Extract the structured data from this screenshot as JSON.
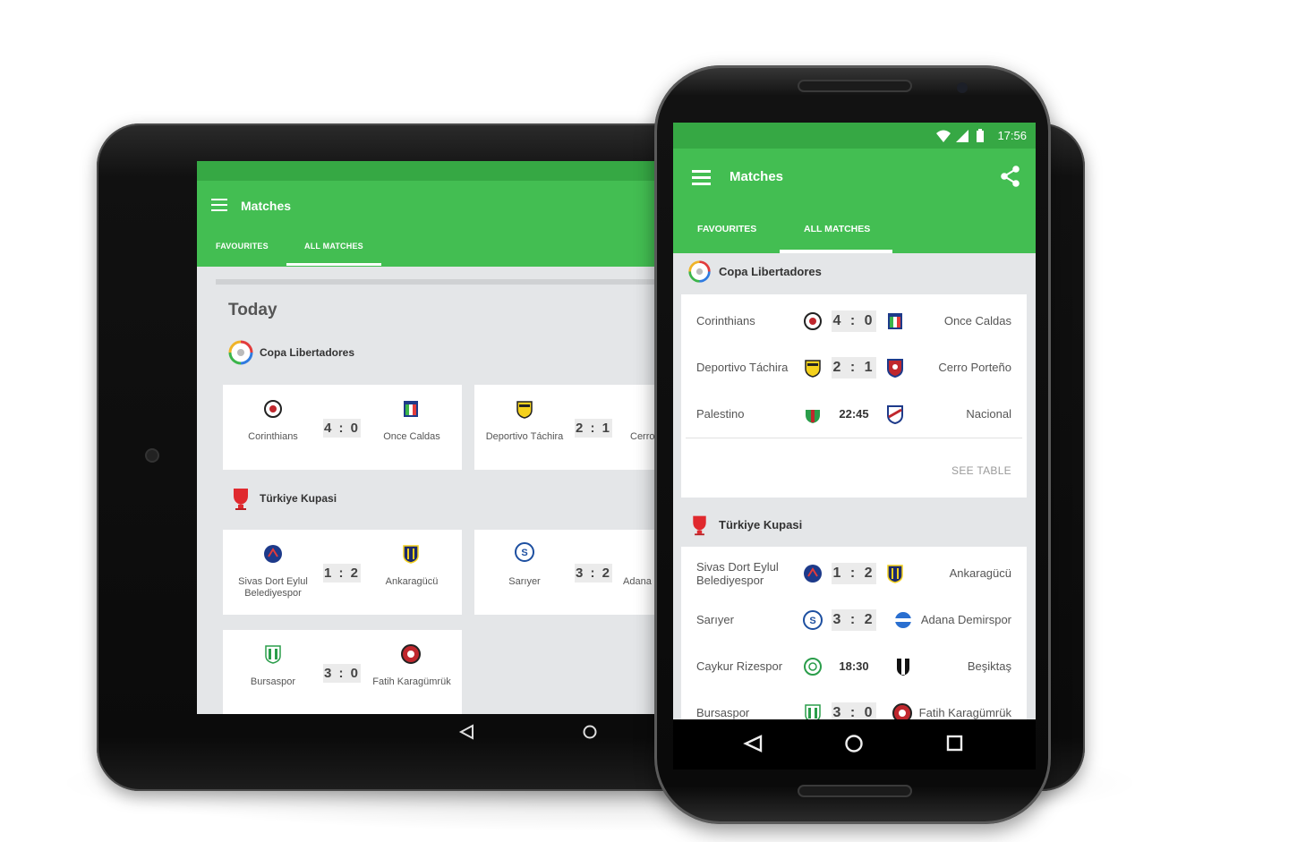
{
  "tablet": {
    "app_title": "Matches",
    "tabs": [
      {
        "label": "FAVOURITES"
      },
      {
        "label": "ALL MATCHES"
      }
    ],
    "section_title": "Today",
    "competitions": [
      {
        "name": "Copa Libertadores"
      },
      {
        "name": "Türkiye Kupasi"
      }
    ],
    "cards": [
      {
        "home": "Corinthians",
        "score": "4 : 0",
        "away": "Once Caldas"
      },
      {
        "home": "Deportivo Táchira",
        "score": "2 : 1",
        "away": "Cerro"
      },
      {
        "home": "Sivas Dort Eylul Belediyespor",
        "score": "1 : 2",
        "away": "Ankaragücü"
      },
      {
        "home": "Sarıyer",
        "score": "3 : 2",
        "away": "Adana"
      },
      {
        "home": "Bursaspor",
        "score": "3 : 0",
        "away": "Fatih Karagümrük"
      }
    ]
  },
  "phone": {
    "status_time": "17:56",
    "app_title": "Matches",
    "tabs": [
      {
        "label": "FAVOURITES"
      },
      {
        "label": "ALL MATCHES"
      }
    ],
    "competitions": [
      {
        "name": "Copa Libertadores",
        "matches": [
          {
            "home": "Corinthians",
            "score": "4 : 0",
            "away": "Once Caldas"
          },
          {
            "home": "Deportivo Táchira",
            "score": "2 : 1",
            "away": "Cerro Porteño"
          },
          {
            "home": "Palestino",
            "kickoff": "22:45",
            "away": "Nacional"
          }
        ],
        "see_table": "SEE TABLE"
      },
      {
        "name": "Türkiye Kupasi",
        "matches": [
          {
            "home": "Sivas Dort Eylul Belediyespor",
            "score": "1 : 2",
            "away": "Ankaragücü"
          },
          {
            "home": "Sarıyer",
            "score": "3 : 2",
            "away": "Adana Demirspor"
          },
          {
            "home": "Caykur Rizespor",
            "kickoff": "18:30",
            "away": "Beşiktaş"
          },
          {
            "home": "Bursaspor",
            "score": "3 : 0",
            "away": "Fatih Karagümrük"
          }
        ]
      }
    ]
  },
  "colors": {
    "toolbar": "#43be52",
    "status_bar": "#36a844",
    "background": "#e4e6e8",
    "score_bg": "#ebebeb"
  },
  "icons": [
    "menu-icon",
    "share-icon",
    "wifi-icon",
    "signal-icon",
    "battery-icon",
    "back-icon",
    "home-icon",
    "recents-icon"
  ]
}
